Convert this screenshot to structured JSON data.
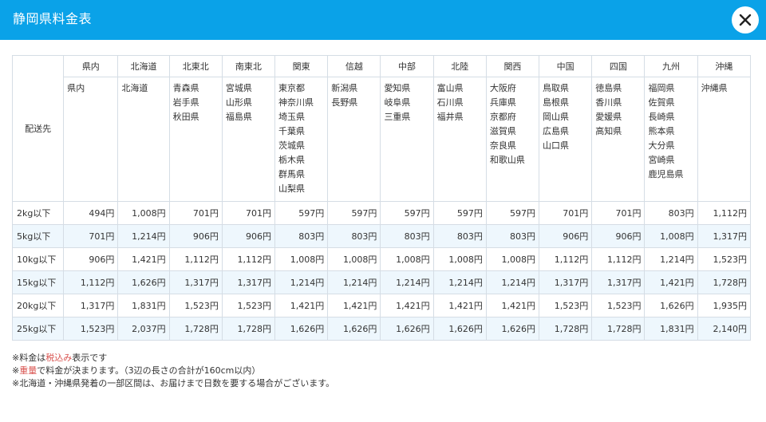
{
  "header": {
    "title": "静岡県料金表"
  },
  "table": {
    "corner_label": "配送先",
    "regions": [
      {
        "name": "県内",
        "prefs": [
          "県内"
        ]
      },
      {
        "name": "北海道",
        "prefs": [
          "北海道"
        ]
      },
      {
        "name": "北東北",
        "prefs": [
          "青森県",
          "岩手県",
          "秋田県"
        ]
      },
      {
        "name": "南東北",
        "prefs": [
          "宮城県",
          "山形県",
          "福島県"
        ]
      },
      {
        "name": "関東",
        "prefs": [
          "東京都",
          "神奈川県",
          "埼玉県",
          "千葉県",
          "茨城県",
          "栃木県",
          "群馬県",
          "山梨県"
        ]
      },
      {
        "name": "信越",
        "prefs": [
          "新潟県",
          "長野県"
        ]
      },
      {
        "name": "中部",
        "prefs": [
          "愛知県",
          "岐阜県",
          "三重県"
        ]
      },
      {
        "name": "北陸",
        "prefs": [
          "富山県",
          "石川県",
          "福井県"
        ]
      },
      {
        "name": "関西",
        "prefs": [
          "大阪府",
          "兵庫県",
          "京都府",
          "滋賀県",
          "奈良県",
          "和歌山県"
        ]
      },
      {
        "name": "中国",
        "prefs": [
          "鳥取県",
          "島根県",
          "岡山県",
          "広島県",
          "山口県"
        ]
      },
      {
        "name": "四国",
        "prefs": [
          "徳島県",
          "香川県",
          "愛媛県",
          "高知県"
        ]
      },
      {
        "name": "九州",
        "prefs": [
          "福岡県",
          "佐賀県",
          "長崎県",
          "熊本県",
          "大分県",
          "宮崎県",
          "鹿児島県"
        ]
      },
      {
        "name": "沖縄",
        "prefs": [
          "沖縄県"
        ]
      }
    ],
    "rows": [
      {
        "weight": "2kg以下",
        "prices": [
          "494円",
          "1,008円",
          "701円",
          "701円",
          "597円",
          "597円",
          "597円",
          "597円",
          "597円",
          "701円",
          "701円",
          "803円",
          "1,112円"
        ]
      },
      {
        "weight": "5kg以下",
        "prices": [
          "701円",
          "1,214円",
          "906円",
          "906円",
          "803円",
          "803円",
          "803円",
          "803円",
          "803円",
          "906円",
          "906円",
          "1,008円",
          "1,317円"
        ]
      },
      {
        "weight": "10kg以下",
        "prices": [
          "906円",
          "1,421円",
          "1,112円",
          "1,112円",
          "1,008円",
          "1,008円",
          "1,008円",
          "1,008円",
          "1,008円",
          "1,112円",
          "1,112円",
          "1,214円",
          "1,523円"
        ]
      },
      {
        "weight": "15kg以下",
        "prices": [
          "1,112円",
          "1,626円",
          "1,317円",
          "1,317円",
          "1,214円",
          "1,214円",
          "1,214円",
          "1,214円",
          "1,214円",
          "1,317円",
          "1,317円",
          "1,421円",
          "1,728円"
        ]
      },
      {
        "weight": "20kg以下",
        "prices": [
          "1,317円",
          "1,831円",
          "1,523円",
          "1,523円",
          "1,421円",
          "1,421円",
          "1,421円",
          "1,421円",
          "1,421円",
          "1,523円",
          "1,523円",
          "1,626円",
          "1,935円"
        ]
      },
      {
        "weight": "25kg以下",
        "prices": [
          "1,523円",
          "2,037円",
          "1,728円",
          "1,728円",
          "1,626円",
          "1,626円",
          "1,626円",
          "1,626円",
          "1,626円",
          "1,728円",
          "1,728円",
          "1,831円",
          "2,140円"
        ]
      }
    ]
  },
  "notes": {
    "line1_prefix": "※料金は",
    "line1_highlight": "税込み",
    "line1_suffix": "表示です",
    "line2_prefix": "※",
    "line2_highlight": "重量",
    "line2_suffix": "で料金が決まります。（3辺の長さの合計が160cm以内）",
    "line3": "※北海道・沖縄県発着の一部区間は、お届けまで日数を要する場合がございます。"
  },
  "icons": {
    "close": "close-icon"
  },
  "colors": {
    "header_bg": "#0aa2e8",
    "alt_row_bg": "#eef7fd",
    "highlight_red": "#d9534f"
  }
}
